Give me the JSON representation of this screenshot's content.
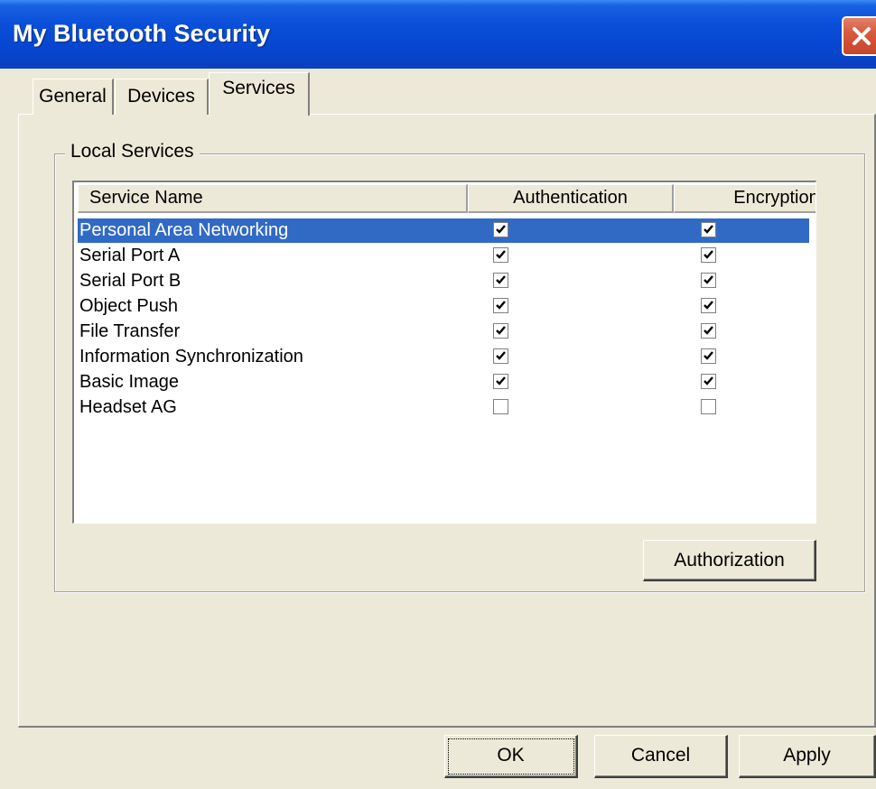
{
  "window": {
    "title": "My Bluetooth Security"
  },
  "tabs": [
    "General",
    "Devices",
    "Services"
  ],
  "active_tab": "Services",
  "group": {
    "label": "Local Services"
  },
  "table": {
    "columns": [
      "Service Name",
      "Authentication",
      "Encryption"
    ],
    "rows": [
      {
        "name": "Personal Area Networking",
        "authentication": true,
        "encryption": true,
        "selected": true
      },
      {
        "name": "Serial Port A",
        "authentication": true,
        "encryption": true,
        "selected": false
      },
      {
        "name": "Serial Port B",
        "authentication": true,
        "encryption": true,
        "selected": false
      },
      {
        "name": "Object Push",
        "authentication": true,
        "encryption": true,
        "selected": false
      },
      {
        "name": "File Transfer",
        "authentication": true,
        "encryption": true,
        "selected": false
      },
      {
        "name": "Information Synchronization",
        "authentication": true,
        "encryption": true,
        "selected": false
      },
      {
        "name": "Basic Image",
        "authentication": true,
        "encryption": true,
        "selected": false
      },
      {
        "name": "Headset AG",
        "authentication": false,
        "encryption": false,
        "selected": false
      }
    ]
  },
  "buttons": {
    "authorization": "Authorization",
    "ok": "OK",
    "cancel": "Cancel",
    "apply": "Apply"
  },
  "icons": {
    "close": "close-icon",
    "check": "checkmark-icon"
  },
  "colors": {
    "titlebar": "#0a4fd9",
    "selection": "#316ac5",
    "dialog_bg": "#ece9d8",
    "close_button": "#d85a3c"
  }
}
